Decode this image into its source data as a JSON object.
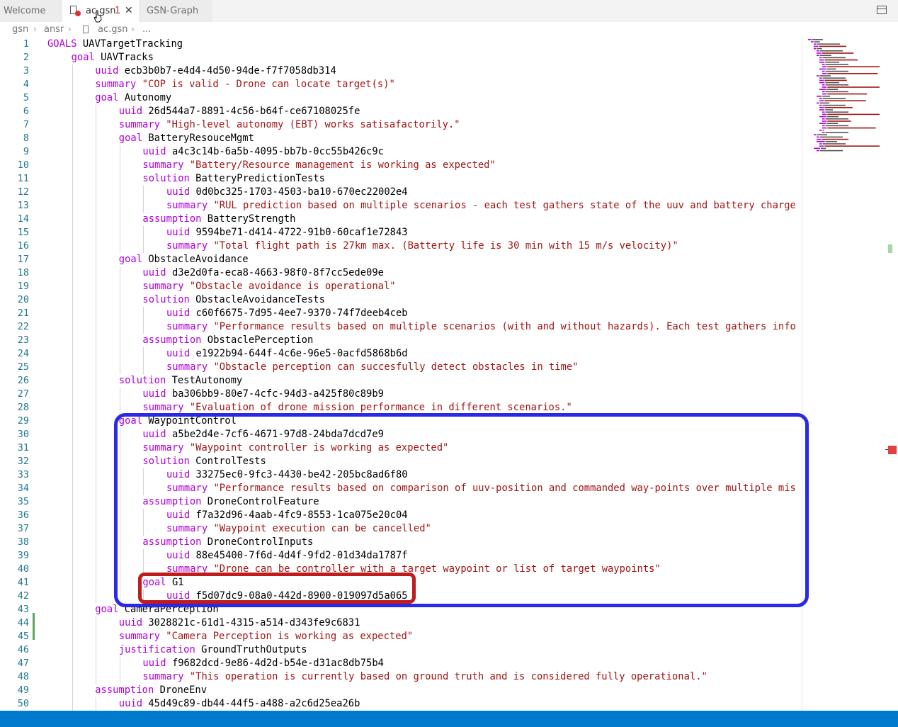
{
  "tabs": [
    {
      "label": "Welcome"
    },
    {
      "label": "ac.gsn",
      "problems": "1",
      "active": true
    },
    {
      "label": "GSN-Graph"
    }
  ],
  "breadcrumb": [
    "gsn",
    "ansr",
    "ac.gsn",
    "..."
  ],
  "lines": [
    {
      "n": "1",
      "indent": 0,
      "kw": "GOALS",
      "rest": "UAVTargetTracking",
      "str": false
    },
    {
      "n": "2",
      "indent": 1,
      "kw": "goal",
      "rest": "UAVTracks",
      "str": false
    },
    {
      "n": "3",
      "indent": 2,
      "kw": "uuid",
      "rest": "ecb3b0b7-e4d4-4d50-94de-f7f7058db314",
      "str": false
    },
    {
      "n": "4",
      "indent": 2,
      "kw": "summary",
      "rest": "\"COP is valid - Drone can locate target(s)\"",
      "str": true
    },
    {
      "n": "5",
      "indent": 2,
      "kw": "goal",
      "rest": "Autonomy",
      "str": false
    },
    {
      "n": "6",
      "indent": 3,
      "kw": "uuid",
      "rest": "26d544a7-8891-4c56-b64f-ce67108025fe",
      "str": false
    },
    {
      "n": "7",
      "indent": 3,
      "kw": "summary",
      "rest": "\"High-level autonomy (EBT) works satisafactorily.\"",
      "str": true
    },
    {
      "n": "8",
      "indent": 3,
      "kw": "goal",
      "rest": "BatteryResouceMgmt",
      "str": false
    },
    {
      "n": "9",
      "indent": 4,
      "kw": "uuid",
      "rest": "a4c3c14b-6a5b-4095-bb7b-0cc55b426c9c",
      "str": false
    },
    {
      "n": "10",
      "indent": 4,
      "kw": "summary",
      "rest": "\"Battery/Resource management is working as expected\"",
      "str": true
    },
    {
      "n": "11",
      "indent": 4,
      "kw": "solution",
      "rest": "BatteryPredictionTests",
      "str": false
    },
    {
      "n": "12",
      "indent": 5,
      "kw": "uuid",
      "rest": "0d0bc325-1703-4503-ba10-670ec22002e4",
      "str": false
    },
    {
      "n": "13",
      "indent": 5,
      "kw": "summary",
      "rest": "\"RUL prediction based on multiple scenarios - each test gathers state of the uuv and battery charge",
      "str": true
    },
    {
      "n": "14",
      "indent": 4,
      "kw": "assumption",
      "rest": "BatteryStrength",
      "str": false
    },
    {
      "n": "15",
      "indent": 5,
      "kw": "uuid",
      "rest": "9594be71-d414-4722-91b0-60caf1e72843",
      "str": false
    },
    {
      "n": "16",
      "indent": 5,
      "kw": "summary",
      "rest": "\"Total flight path is 27km max. (Batterty life is 30 min with 15 m/s velocity)\"",
      "str": true
    },
    {
      "n": "17",
      "indent": 3,
      "kw": "goal",
      "rest": "ObstacleAvoidance",
      "str": false
    },
    {
      "n": "18",
      "indent": 4,
      "kw": "uuid",
      "rest": "d3e2d0fa-eca8-4663-98f0-8f7cc5ede09e",
      "str": false
    },
    {
      "n": "19",
      "indent": 4,
      "kw": "summary",
      "rest": "\"Obstacle avoidance is operational\"",
      "str": true
    },
    {
      "n": "20",
      "indent": 4,
      "kw": "solution",
      "rest": "ObstacleAvoidanceTests",
      "str": false
    },
    {
      "n": "21",
      "indent": 5,
      "kw": "uuid",
      "rest": "c60f6675-7d95-4ee7-9370-74f7deeb4ceb",
      "str": false
    },
    {
      "n": "22",
      "indent": 5,
      "kw": "summary",
      "rest": "\"Performance results based on multiple scenarios (with and without hazards). Each test gathers info",
      "str": true
    },
    {
      "n": "23",
      "indent": 4,
      "kw": "assumption",
      "rest": "ObstaclePerception",
      "str": false
    },
    {
      "n": "24",
      "indent": 5,
      "kw": "uuid",
      "rest": "e1922b94-644f-4c6e-96e5-0acfd5868b6d",
      "str": false
    },
    {
      "n": "25",
      "indent": 5,
      "kw": "summary",
      "rest": "\"Obstacle perception can succesfully detect obstacles in time\"",
      "str": true
    },
    {
      "n": "26",
      "indent": 3,
      "kw": "solution",
      "rest": "TestAutonomy",
      "str": false
    },
    {
      "n": "27",
      "indent": 4,
      "kw": "uuid",
      "rest": "ba306bb9-80e7-4cfc-94d3-a425f80c89b9",
      "str": false
    },
    {
      "n": "28",
      "indent": 4,
      "kw": "summary",
      "rest": "\"Evaluation of drone mission performance in different scenarios.\"",
      "str": true
    },
    {
      "n": "29",
      "indent": 3,
      "kw": "goal",
      "rest": "WaypointControl",
      "str": false
    },
    {
      "n": "30",
      "indent": 4,
      "kw": "uuid",
      "rest": "a5be2d4e-7cf6-4671-97d8-24bda7dcd7e9",
      "str": false
    },
    {
      "n": "31",
      "indent": 4,
      "kw": "summary",
      "rest": "\"Waypoint controller is working as expected\"",
      "str": true
    },
    {
      "n": "32",
      "indent": 4,
      "kw": "solution",
      "rest": "ControlTests",
      "str": false
    },
    {
      "n": "33",
      "indent": 5,
      "kw": "uuid",
      "rest": "33275ec0-9fc3-4430-be42-205bc8ad6f80",
      "str": false
    },
    {
      "n": "34",
      "indent": 5,
      "kw": "summary",
      "rest": "\"Performance results based on comparison of uuv-position and commanded way-points over multiple mis",
      "str": true
    },
    {
      "n": "35",
      "indent": 4,
      "kw": "assumption",
      "rest": "DroneControlFeature",
      "str": false
    },
    {
      "n": "36",
      "indent": 5,
      "kw": "uuid",
      "rest": "f7a32d96-4aab-4fc9-8553-1ca075e20c04",
      "str": false
    },
    {
      "n": "37",
      "indent": 5,
      "kw": "summary",
      "rest": "\"Waypoint execution can be cancelled\"",
      "str": true
    },
    {
      "n": "38",
      "indent": 4,
      "kw": "assumption",
      "rest": "DroneControlInputs",
      "str": false
    },
    {
      "n": "39",
      "indent": 5,
      "kw": "uuid",
      "rest": "88e45400-7f6d-4d4f-9fd2-01d34da1787f",
      "str": false
    },
    {
      "n": "40",
      "indent": 5,
      "kw": "summary",
      "rest": "\"Drone can be controller with a target waypoint or list of target waypoints\"",
      "str": true
    },
    {
      "n": "41",
      "indent": 4,
      "kw": "goal",
      "rest": "G1",
      "str": false
    },
    {
      "n": "42",
      "indent": 5,
      "kw": "uuid",
      "rest": "f5d07dc9-08a0-442d-8900-019097d5a065",
      "str": false
    },
    {
      "n": "43",
      "indent": 2,
      "kw": "goal",
      "rest": "CameraPerception",
      "str": false
    },
    {
      "n": "44",
      "indent": 3,
      "kw": "uuid",
      "rest": "3028821c-61d1-4315-a514-d343fe9c6831",
      "str": false
    },
    {
      "n": "45",
      "indent": 3,
      "kw": "summary",
      "rest": "\"Camera Perception is working as expected\"",
      "str": true
    },
    {
      "n": "46",
      "indent": 3,
      "kw": "justification",
      "rest": "GroundTruthOutputs",
      "str": false
    },
    {
      "n": "47",
      "indent": 4,
      "kw": "uuid",
      "rest": "f9682dcd-9e86-4d2d-b54e-d31ac8db75b4",
      "str": false
    },
    {
      "n": "48",
      "indent": 4,
      "kw": "summary",
      "rest": "\"This operation is currently based on ground truth and is considered fully operational.\"",
      "str": true
    },
    {
      "n": "49",
      "indent": 2,
      "kw": "assumption",
      "rest": "DroneEnv",
      "str": false
    },
    {
      "n": "50",
      "indent": 3,
      "kw": "uuid",
      "rest": "45d49c89-db44-44f5-a488-a2c6d25ea26b",
      "str": false
    }
  ],
  "colors": {
    "keyword": "#af00db",
    "string": "#a31515",
    "accent": "#007acc",
    "highlight_blue": "#2a2ae6",
    "highlight_red": "#c01c1c"
  },
  "icons": [
    "file-icon",
    "error-icon",
    "close-icon",
    "split-editor-icon",
    "pointer-cursor-icon"
  ]
}
